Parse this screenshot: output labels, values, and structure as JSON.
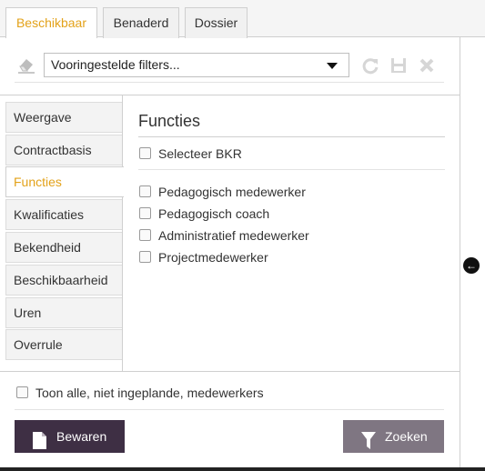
{
  "tabs": [
    {
      "label": "Beschikbaar",
      "active": true
    },
    {
      "label": "Benaderd",
      "active": false
    },
    {
      "label": "Dossier",
      "active": false
    }
  ],
  "filter": {
    "selected": "Vooringestelde filters...",
    "icons": [
      "eraser-icon",
      "refresh-icon",
      "save-icon",
      "close-icon"
    ]
  },
  "sidebar": {
    "items": [
      {
        "label": "Weergave",
        "active": false
      },
      {
        "label": "Contractbasis",
        "active": false
      },
      {
        "label": "Functies",
        "active": true
      },
      {
        "label": "Kwalificaties",
        "active": false
      },
      {
        "label": "Bekendheid",
        "active": false
      },
      {
        "label": "Beschikbaarheid",
        "active": false
      },
      {
        "label": "Uren",
        "active": false
      },
      {
        "label": "Overrule",
        "active": false
      }
    ]
  },
  "main": {
    "title": "Functies",
    "select_all": "Selecteer BKR",
    "options": [
      {
        "label": "Pedagogisch medewerker",
        "checked": false
      },
      {
        "label": "Pedagogisch coach",
        "checked": false
      },
      {
        "label": "Administratief medewerker",
        "checked": false
      },
      {
        "label": "Projectmedewerker",
        "checked": false
      }
    ]
  },
  "footer": {
    "show_all_label": "Toon alle, niet ingeplande, medewerkers",
    "save_label": "Bewaren",
    "search_label": "Zoeken"
  },
  "colors": {
    "accent": "#e3a21a",
    "save_button": "#3e2f44",
    "search_button": "#7f7682"
  }
}
